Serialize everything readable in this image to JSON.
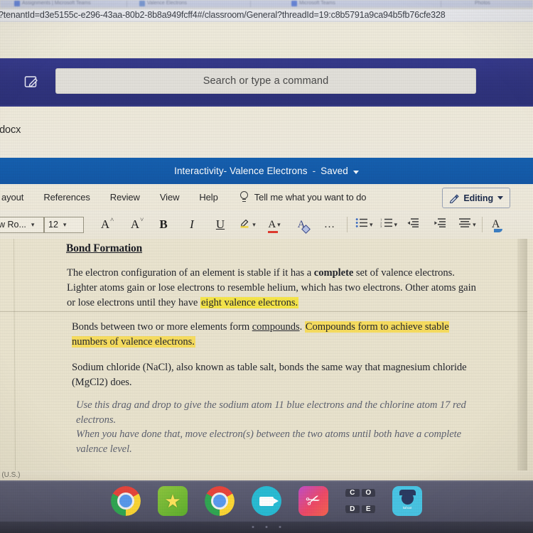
{
  "browser": {
    "tabs": [
      {
        "title": "Assignments | Microsoft Teams",
        "favicon": "teams-icon"
      },
      {
        "title": "Valence Electrons",
        "favicon": "search-icon"
      },
      {
        "title": "Microsoft Teams",
        "favicon": "teams-icon"
      },
      {
        "title": "Photos",
        "favicon": "photos-icon"
      }
    ],
    "url": "?tenantId=d3e5155c-e296-43aa-80b2-8b8a949fcff4#/classroom/General?threadId=19:c8b5791a9ca94b5fb76cfe328"
  },
  "teams": {
    "compose_icon": "compose-pencil-icon",
    "search_placeholder": "Search or type a command"
  },
  "word": {
    "filename": "s.docx",
    "doc_title": "Interactivity- Valence Electrons",
    "save_state": "Saved",
    "title_separator": "-",
    "ribbon_tabs": [
      "ayout",
      "References",
      "Review",
      "View",
      "Help"
    ],
    "tell_me": "Tell me what you want to do",
    "tell_me_icon": "lightbulb-icon",
    "editing_button": {
      "label": "Editing",
      "icon": "pencil-icon"
    },
    "toolbar": {
      "font_name": "w Ro...",
      "font_size": "12",
      "grow_font": "A",
      "grow_font_sup": "˄",
      "shrink_font": "A",
      "shrink_font_sup": "˅",
      "bold": "B",
      "italic": "I",
      "underline": "U",
      "highlight_icon": "highlight-marker-icon",
      "font_color_icon": "font-color-icon",
      "font_color_letter": "A",
      "clear_formatting_icon": "clear-formatting-icon",
      "more_options": "…",
      "bullets_icon": "bulleted-list-icon",
      "numbering_icon": "numbered-list-icon",
      "decrease_indent_icon": "decrease-indent-icon",
      "increase_indent_icon": "increase-indent-icon",
      "align_icon": "align-paragraph-icon",
      "styles_icon": "styles-icon"
    },
    "status_language": "h (U.S.)"
  },
  "document": {
    "heading": "Bond Formation",
    "para1": {
      "seg1": "The electron configuration of an element is stable if it has a ",
      "bold1": "complete",
      "seg2": " set of valence electrons. Lighter atoms gain or lose electrons to resemble helium, which has two electrons. Other atoms gain or lose electrons until they have ",
      "highlight1": "eight valence electrons."
    },
    "para2": {
      "seg1": "Bonds between two or more elements form ",
      "underline1": "compounds",
      "seg2": ". ",
      "highlight1": "Compounds form to achieve stable numbers of valence electrons."
    },
    "para3": "Sodium chloride (NaCl), also known as table salt, bonds the same way that magnesium chloride (MgCl2) does.",
    "para4_line1": "Use this drag and drop to give the sodium atom 11 blue electrons and the chlorine atom 17 red electrons.",
    "para4_line2": "When you have done that, move electron(s) between the two atoms until both have a complete valence level."
  },
  "shelf": {
    "apps": [
      {
        "name": "chrome-app",
        "label": ""
      },
      {
        "name": "star-app",
        "label": "★"
      },
      {
        "name": "chrome-app-2",
        "label": ""
      },
      {
        "name": "camera-app",
        "label": ""
      },
      {
        "name": "pink-app",
        "label": "✂"
      },
      {
        "name": "code-org-app",
        "letters": [
          "C",
          "O",
          "D",
          "E"
        ]
      },
      {
        "name": "kahoot-app",
        "label": "kahoot"
      }
    ]
  },
  "colors": {
    "teams_purple": "#30347f",
    "word_blue": "#1560b0",
    "highlight_yellow": "#f7e64a",
    "paper": "#eae4cf",
    "shelf": "#55566b"
  }
}
